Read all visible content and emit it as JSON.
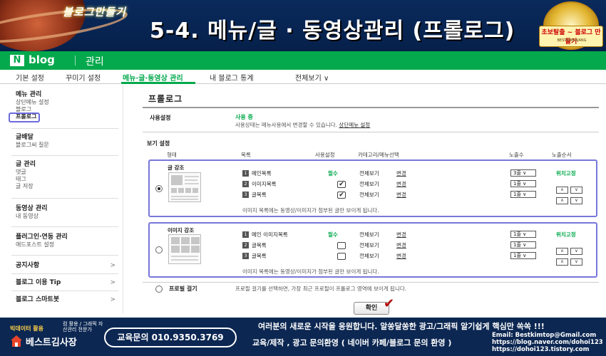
{
  "banner": {
    "brand": "블로그만들기",
    "title": "5-4. 메뉴/글 · 동영상관리 (프롤로그)",
    "badge_text": "초보탈출 ~ 블로그 만들기",
    "badge_sub": "BESTKIMSAJANG"
  },
  "header": {
    "logo_letter": "N",
    "logo_text": "blog",
    "section": "관리"
  },
  "tabs": [
    {
      "label": "기본 설정"
    },
    {
      "label": "꾸미기 설정"
    },
    {
      "label": "메뉴·글·동영상 관리"
    },
    {
      "label": "내 블로그 통계"
    },
    {
      "label": "전체보기 ∨"
    }
  ],
  "sidebar": {
    "groups": [
      {
        "title": "메뉴 관리",
        "items": [
          "상단메뉴 설정",
          "블로그",
          "프롤로그"
        ]
      },
      {
        "title": "글배달",
        "items": [
          "블로그씨 질문"
        ]
      },
      {
        "title": "글 관리",
        "items": [
          "댓글",
          "태그",
          "글 저장"
        ]
      },
      {
        "title": "동영상 관리",
        "items": [
          "내 동영상"
        ]
      },
      {
        "title": "플러그인·연동 관리",
        "items": [
          "애드포스트 설정"
        ]
      },
      {
        "title": "공지사항",
        "items": []
      },
      {
        "title": "블로그 이용 Tip",
        "items": []
      },
      {
        "title": "블로그 스마트봇",
        "items": []
      }
    ],
    "arrow": ">"
  },
  "content": {
    "title": "프롤로그",
    "usage": {
      "label": "사용설정",
      "status": "사용 중",
      "desc": "사용상태는 메뉴사용에서 변경할 수 있습니다.",
      "link": "상단메뉴 설정"
    },
    "view_label": "보기 설정",
    "columns": [
      "형태",
      "목록",
      "사용설정",
      "카테고리/메뉴선택",
      "노출수",
      "노출순서"
    ],
    "options": [
      {
        "title": "글 강조",
        "selected": true,
        "rows": [
          {
            "num": "1",
            "name": "메인목록",
            "use": "필수",
            "checked": null,
            "cat": "전체보기",
            "edit": "변경",
            "count": "3줄",
            "order": "위치고정"
          },
          {
            "num": "2",
            "name": "이미지목록",
            "use": "",
            "checked": true,
            "cat": "전체보기",
            "edit": "변경",
            "count": "1줄",
            "order": ""
          },
          {
            "num": "3",
            "name": "글목록",
            "use": "",
            "checked": true,
            "cat": "전체보기",
            "edit": "변경",
            "count": "1줄",
            "order": ""
          }
        ],
        "note": "이미지 목록에는 동영상/이미지가 첨부된 글만 보이게 됩니다."
      },
      {
        "title": "이미지 강조",
        "selected": false,
        "rows": [
          {
            "num": "1",
            "name": "메인 이미지목록",
            "use": "필수",
            "checked": null,
            "cat": "전체보기",
            "edit": "변경",
            "count": "1줄",
            "order": "위치고정"
          },
          {
            "num": "2",
            "name": "글목록",
            "use": "",
            "checked": false,
            "cat": "전체보기",
            "edit": "변경",
            "count": "1줄",
            "order": ""
          },
          {
            "num": "3",
            "name": "글목록",
            "use": "",
            "checked": false,
            "cat": "전체보기",
            "edit": "변경",
            "count": "1줄",
            "order": ""
          }
        ],
        "note": "이미지 목록에는 동영상/이미지가 첨부된 글만 보이게 됩니다."
      }
    ],
    "prologue": {
      "label": "프로필 걸기",
      "desc": "프로필 걸기를 선택하면, 가장 최근 프로필이 프롤로그 영역에 보이게 됩니다."
    },
    "confirm": "확인"
  },
  "footer": {
    "logo_top": "빅데이터 활용",
    "logo_sub": "컴 활용 / 그래픽 자산관리 전문가",
    "logo_name": "베스트김사장",
    "phone": "교육문의 010.9350.3769",
    "message": "여러분의 새로운 시작을 응원합니다. 알쏭달쏭한 광고/그래픽 알기쉽게 핵심만 쏙쏙 !!!",
    "edu": "교육/제작 , 광고 문의환영 ( 네이버 카페/블로그 문의 환영 )",
    "email": "Email: Bestkimtop@Gmail.com",
    "blog": "https://blog.naver.com/dohoi123",
    "tistory": "https://dohoi123.tistory.com"
  },
  "colors": {
    "naver_green": "#03a94c",
    "highlight": "#7777d9",
    "navy": "#0c2752"
  }
}
